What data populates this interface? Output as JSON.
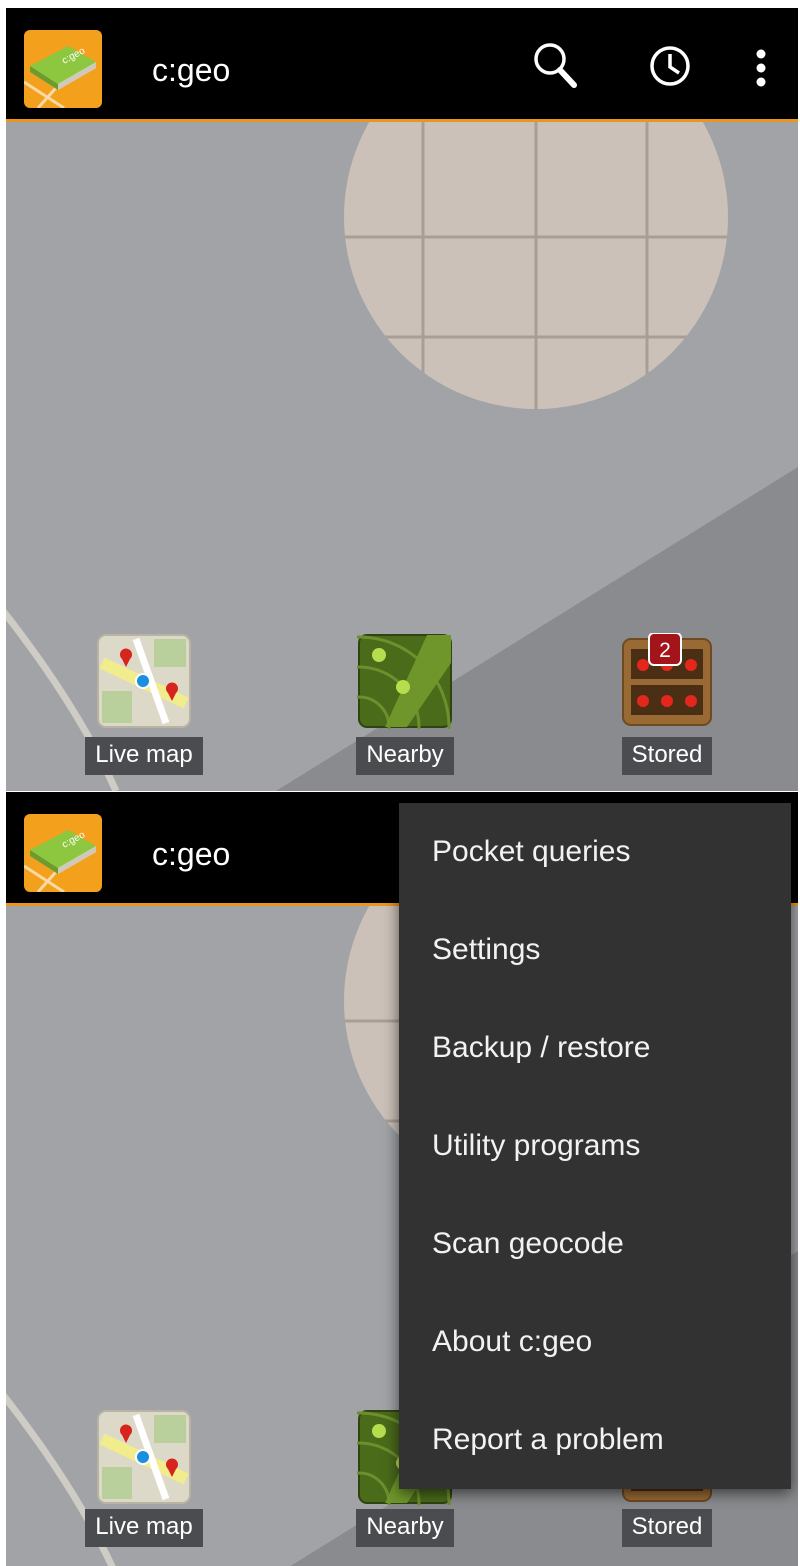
{
  "app": {
    "title": "c:geo"
  },
  "toolbar": {
    "icons": [
      "search-icon",
      "history-icon",
      "overflow-menu-icon"
    ]
  },
  "tiles": [
    {
      "label": "Live map",
      "icon": "live-map-icon"
    },
    {
      "label": "Nearby",
      "icon": "nearby-radar-icon"
    },
    {
      "label": "Stored",
      "icon": "stored-caches-icon",
      "badge": "2"
    }
  ],
  "menu": {
    "items": [
      "Pocket queries",
      "Settings",
      "Backup / restore",
      "Utility programs",
      "Scan geocode",
      "About c:geo",
      "Report a problem"
    ]
  },
  "colors": {
    "accent": "#e8961c",
    "actionbar": "#000000",
    "background": "#a1a3a6",
    "menu_background": "#323232",
    "badge": "#a3141b"
  }
}
